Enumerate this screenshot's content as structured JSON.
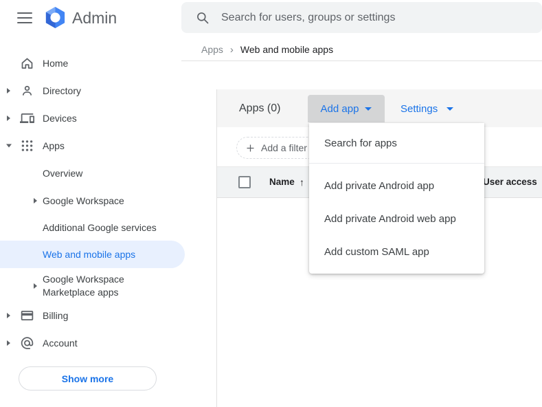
{
  "app": {
    "name": "Admin",
    "search_placeholder": "Search for users, groups or settings"
  },
  "breadcrumb": {
    "parent": "Apps",
    "separator": "›",
    "current": "Web and mobile apps"
  },
  "sidebar": {
    "items": [
      {
        "label": "Home",
        "icon": "home-icon",
        "expandable": false
      },
      {
        "label": "Directory",
        "icon": "person-icon",
        "expandable": true
      },
      {
        "label": "Devices",
        "icon": "devices-icon",
        "expandable": true
      },
      {
        "label": "Apps",
        "icon": "apps-grid-icon",
        "expandable": true,
        "expanded": true
      }
    ],
    "apps_children": [
      {
        "label": "Overview"
      },
      {
        "label": "Google Workspace",
        "expandable": true
      },
      {
        "label": "Additional Google services"
      },
      {
        "label": "Web and mobile apps",
        "selected": true
      },
      {
        "label_line1": "Google Workspace",
        "label_line2": "Marketplace apps",
        "expandable": true
      }
    ],
    "bottom_items": [
      {
        "label": "Billing",
        "icon": "credit-card-icon",
        "expandable": true
      },
      {
        "label": "Account",
        "icon": "at-sign-icon",
        "expandable": true
      }
    ],
    "show_more": "Show more"
  },
  "toolbar": {
    "title": "Apps (0)",
    "add_app_label": "Add app",
    "settings_label": "Settings"
  },
  "filter": {
    "add_filter_label": "Add a filter"
  },
  "table": {
    "columns": [
      {
        "label": "Name"
      },
      {
        "label": "User access"
      }
    ],
    "sort_indicator": "↑",
    "rows": []
  },
  "menu": {
    "items": [
      "Search for apps",
      "Add private Android app",
      "Add private Android web app",
      "Add custom SAML app"
    ]
  },
  "icons": {
    "hamburger": "menu-icon",
    "logo": "admin-logo-icon",
    "search": "search-icon",
    "plus": "plus-icon",
    "caret": "dropdown-caret-icon"
  },
  "colors": {
    "accent_blue": "#1a73e8",
    "selected_item_bg": "#e8f0fe",
    "toolbar_bg": "#f5f5f5",
    "table_header_bg": "#f1f3f4",
    "pressed_button_bg": "#d4d5d6",
    "icon_gray": "#5f6368",
    "text_dark": "#202124",
    "divider": "#e0e0e0"
  }
}
